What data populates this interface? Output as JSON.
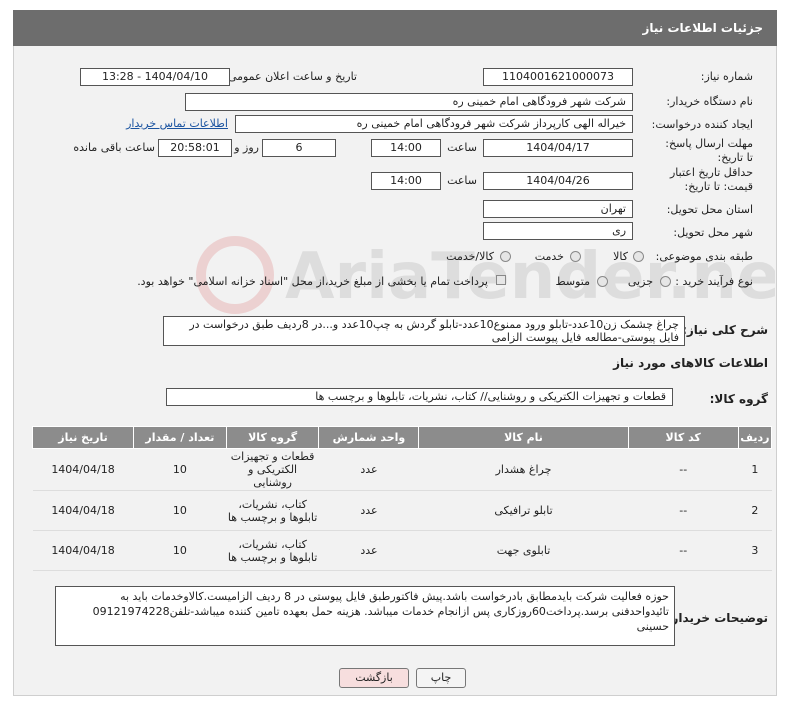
{
  "header": {
    "title": "جزئیات اطلاعات نیاز"
  },
  "form": {
    "need_number_label": "شماره نیاز:",
    "need_number": "1104001621000073",
    "announce_label": "تاریخ و ساعت اعلان عمومی:",
    "announce_value": "1404/04/10 - 13:28",
    "buyer_org_label": "نام دستگاه خریدار:",
    "buyer_org": "شرکت شهر فرودگاهی امام خمینی  ره",
    "requester_label": "ایجاد کننده درخواست:",
    "requester": "خیراله الهی کارپرداز شرکت شهر فرودگاهی امام خمینی  ره",
    "contact_link": "اطلاعات تماس خریدار",
    "reply_deadline_label": "مهلت ارسال پاسخ: تا تاریخ:",
    "reply_date": "1404/04/17",
    "time_label": "ساعت",
    "reply_time": "14:00",
    "days": "6",
    "days_label": "روز و",
    "remaining_time": "20:58:01",
    "remaining_label": "ساعت باقی مانده",
    "price_validity_label": "حداقل تاریخ اعتبار قیمت: تا تاریخ:",
    "price_date": "1404/04/26",
    "price_time": "14:00",
    "province_label": "استان محل تحویل:",
    "province": "تهران",
    "city_label": "شهر محل تحویل:",
    "city": "ری",
    "category_label": "طبقه بندی موضوعی:",
    "category_options": [
      "کالا",
      "خدمت",
      "کالا/خدمت"
    ],
    "process_label": "نوع فرآیند خرید :",
    "process_options": [
      "جزیی",
      "متوسط"
    ],
    "payment_note": "پرداخت تمام یا بخشی از مبلغ خرید،از محل \"اسناد خزانه اسلامی\" خواهد بود."
  },
  "description": {
    "label": "شرح کلی نیاز:",
    "text": "چراغ چشمک زن10عدد-تابلو ورود ممنوع10عدد-تابلو گردش به چپ10عدد و...در 8ردیف طبق درخواست در فایل پیوستی-مطالعه فایل پیوست الزامی"
  },
  "goods_section": {
    "title": "اطلاعات کالاهای مورد نیاز",
    "group_label": "گروه کالا:",
    "group_value": "قطعات و تجهیزات الکتریکی و روشنایی// کتاب، نشریات، تابلوها و برچسب ها"
  },
  "table": {
    "headers": [
      "ردیف",
      "کد کالا",
      "نام کالا",
      "واحد شمارش",
      "گروه کالا",
      "تعداد / مقدار",
      "تاریخ نیاز"
    ],
    "rows": [
      [
        "1",
        "--",
        "چراغ هشدار",
        "عدد",
        "قطعات و تجهیزات الکتریکی و روشنایی",
        "10",
        "1404/04/18"
      ],
      [
        "2",
        "--",
        "تابلو ترافیکی",
        "عدد",
        "کتاب، نشریات، تابلوها و برچسب ها",
        "10",
        "1404/04/18"
      ],
      [
        "3",
        "--",
        "تابلوی جهت",
        "عدد",
        "کتاب، نشریات، تابلوها و برچسب ها",
        "10",
        "1404/04/18"
      ]
    ]
  },
  "buyer_notes": {
    "label": "توضیحات خریدار:",
    "text": "حوزه فعالیت شرکت بایدمطابق بادرخواست باشد.پیش فاکتورطبق فایل پیوستی در 8 ردیف الزامیست.کالاوخدمات باید به تائیدواحدفنی برسد.پرداخت60روزکاری پس ازانجام خدمات میباشد. هزینه حمل بعهده تامین کننده میباشد-تلفن09121974228 حسینی"
  },
  "buttons": {
    "print": "چاپ",
    "back": "بازگشت"
  },
  "colors": {
    "header_bg": "#6d6d6d",
    "table_header_bg": "#8c8c8c",
    "back_button_bg": "#f7dede"
  },
  "watermark": {
    "text": "AriaTender.net"
  }
}
